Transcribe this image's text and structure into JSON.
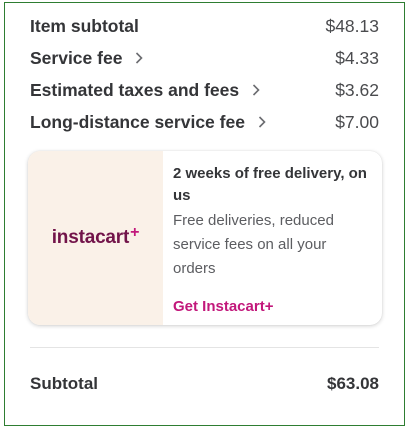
{
  "summary": {
    "rows": [
      {
        "label": "Item subtotal",
        "amount": "$48.13",
        "has_chevron": false
      },
      {
        "label": "Service fee",
        "amount": "$4.33",
        "has_chevron": true
      },
      {
        "label": "Estimated taxes and fees",
        "amount": "$3.62",
        "has_chevron": true
      },
      {
        "label": "Long-distance service fee",
        "amount": "$7.00",
        "has_chevron": true
      }
    ],
    "subtotal_label": "Subtotal",
    "subtotal_amount": "$63.08"
  },
  "promo": {
    "brand_name": "instacart",
    "brand_plus": "+",
    "title": "2 weeks of free delivery, on us",
    "description": "Free deliveries, reduced service fees on all your orders",
    "link_label": "Get Instacart+"
  },
  "colors": {
    "frame_border": "#2e7d32",
    "brand": "#72144a",
    "accent": "#c2187b",
    "promo_bg": "#faf1e8",
    "text": "#343538"
  },
  "icons": {
    "fee_info": "chevron-right-icon"
  }
}
